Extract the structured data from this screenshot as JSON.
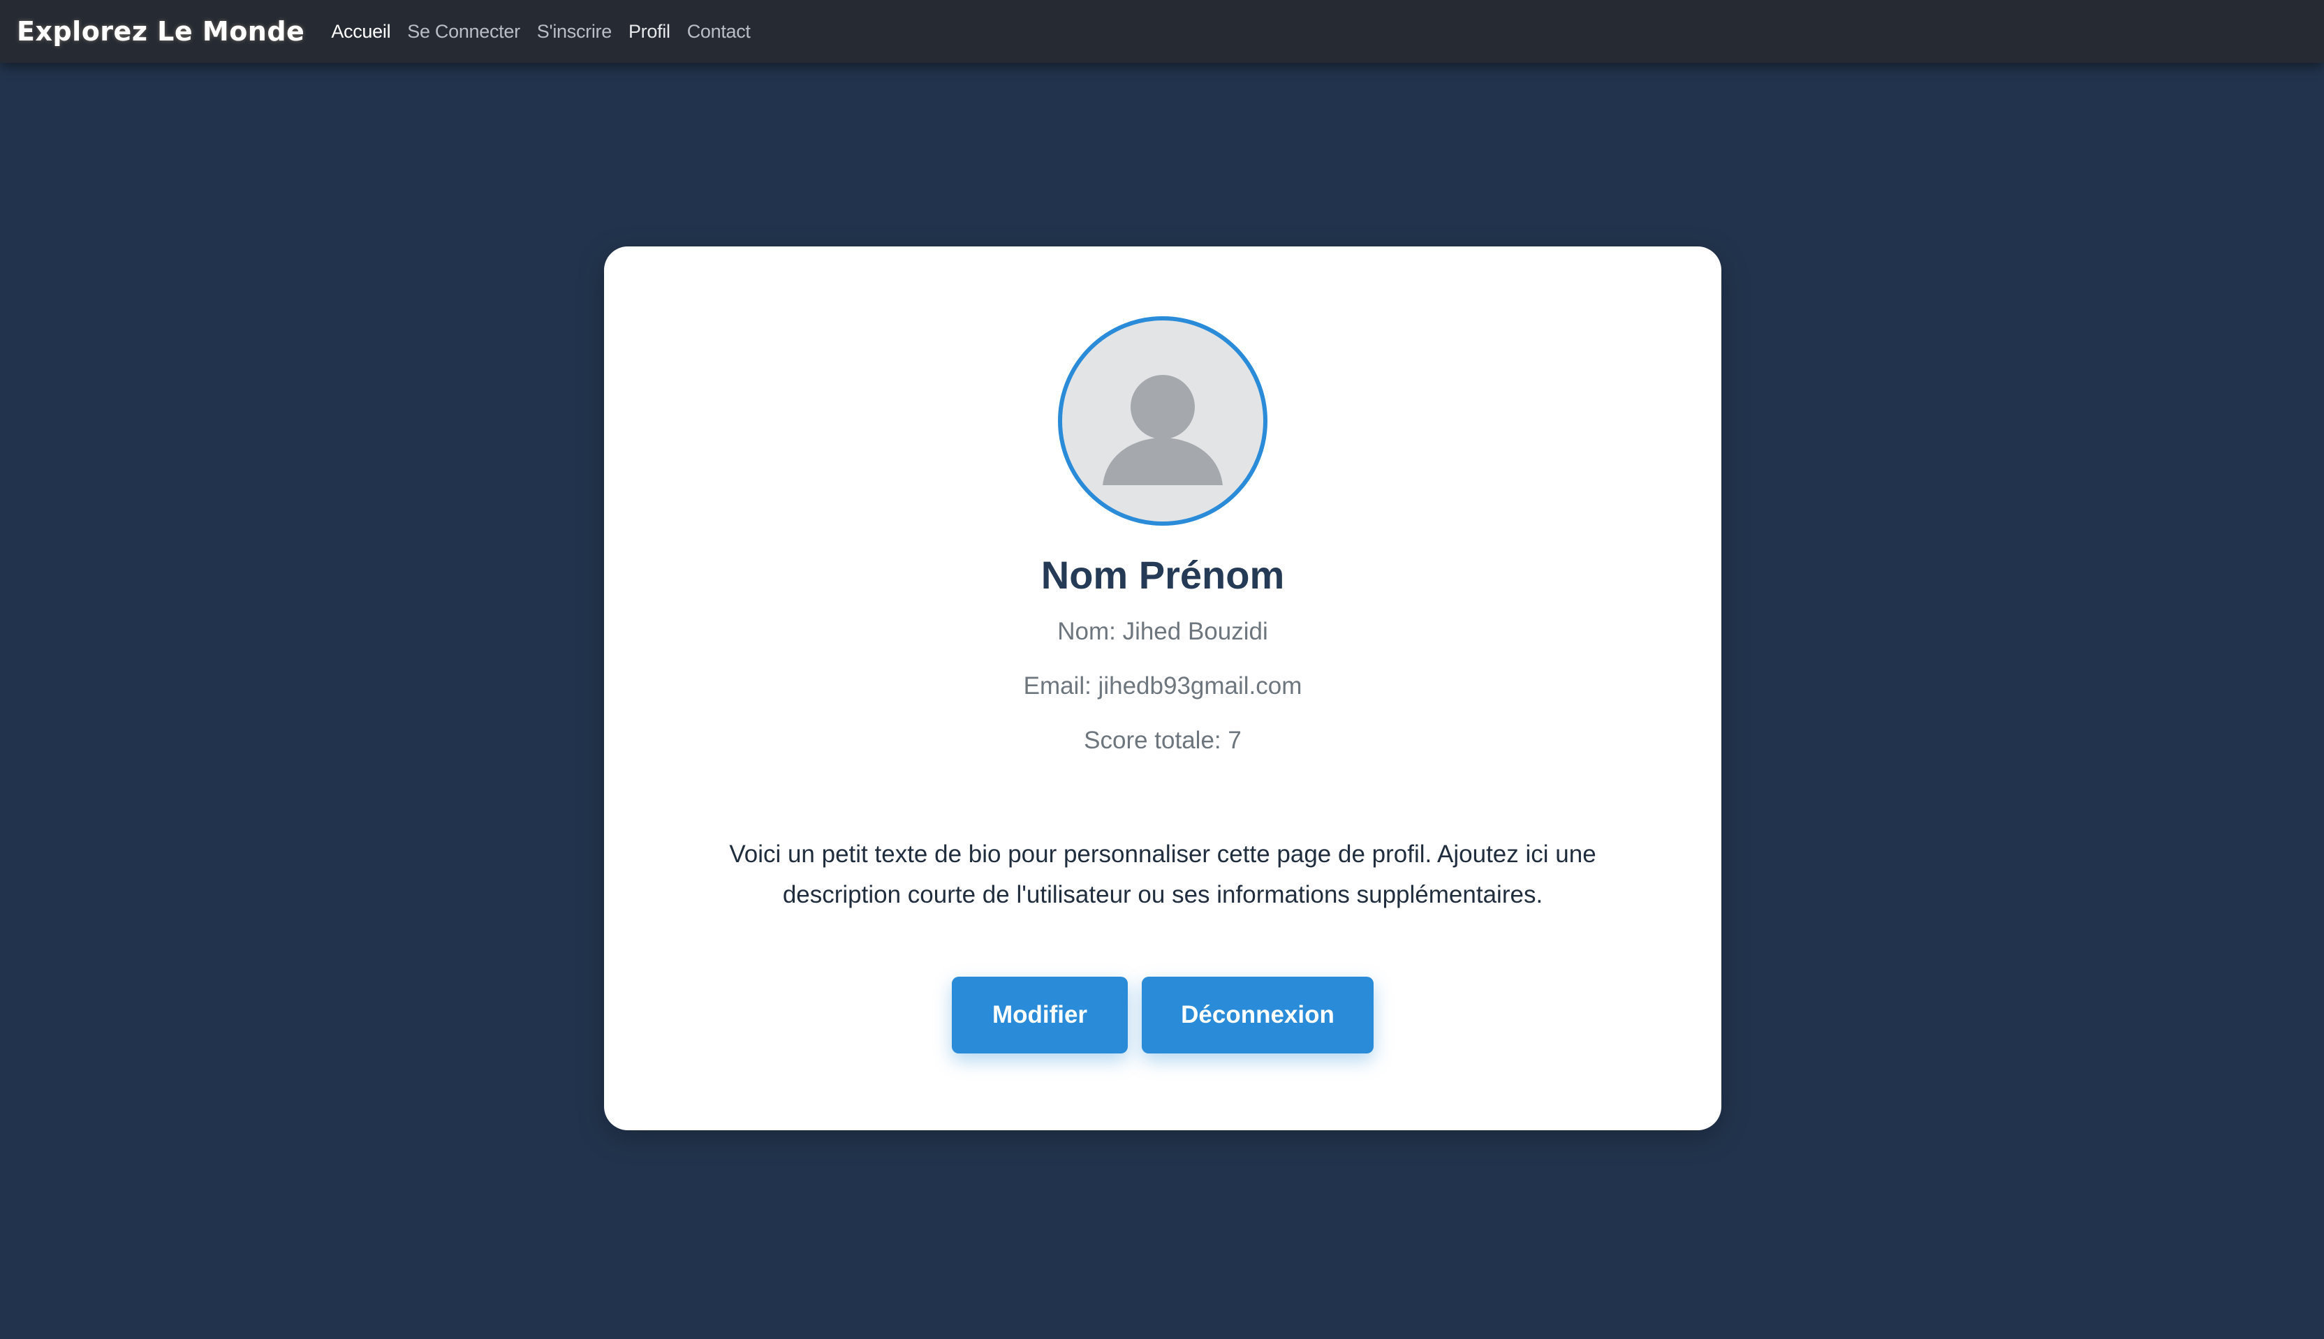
{
  "navbar": {
    "brand": "Explorez Le Monde",
    "links": [
      {
        "label": "Accueil"
      },
      {
        "label": "Se Connecter"
      },
      {
        "label": "S'inscrire"
      },
      {
        "label": "Profil"
      },
      {
        "label": "Contact"
      }
    ]
  },
  "profile": {
    "avatar_icon": "user-avatar-icon",
    "title": "Nom Prénom",
    "name_line": "Nom: Jihed Bouzidi",
    "email_line": "Email: jihedb93gmail.com",
    "score_line": "Score totale: 7",
    "bio": "Voici un petit texte de bio pour personnaliser cette page de profil. Ajoutez ici une description courte de l'utilisateur ou ses informations supplémentaires."
  },
  "actions": {
    "edit_label": "Modifier",
    "logout_label": "Déconnexion"
  },
  "colors": {
    "background": "#22344d",
    "navbar": "#262b33",
    "accent": "#2a8bd8",
    "title": "#243a55"
  }
}
